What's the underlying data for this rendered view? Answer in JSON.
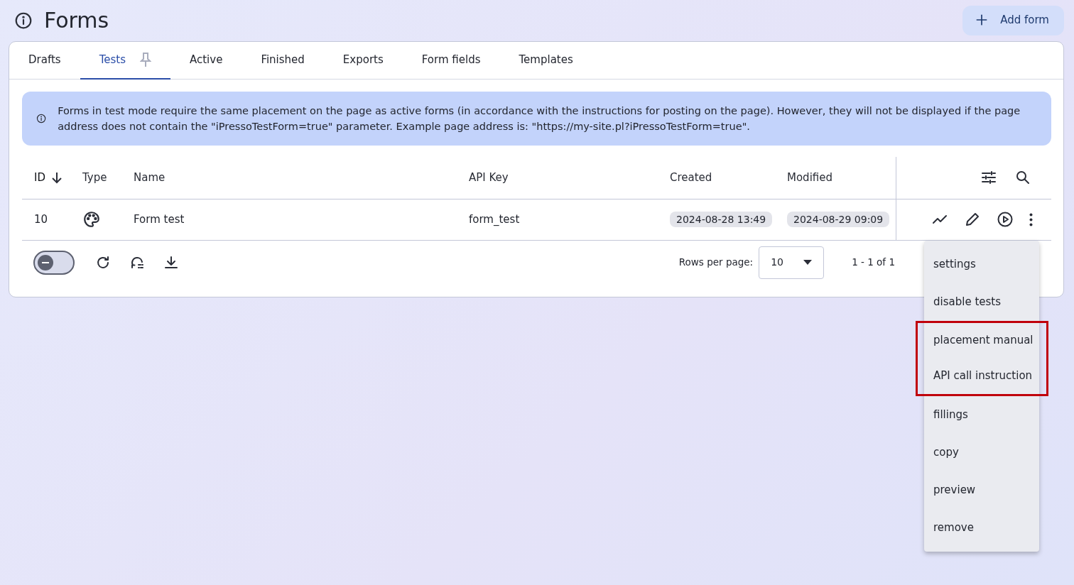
{
  "page": {
    "title": "Forms",
    "add_button": "Add form"
  },
  "tabs": [
    {
      "label": "Drafts",
      "selected": false,
      "pinned": false
    },
    {
      "label": "Tests",
      "selected": true,
      "pinned": true
    },
    {
      "label": "Active",
      "selected": false,
      "pinned": false
    },
    {
      "label": "Finished",
      "selected": false,
      "pinned": false
    },
    {
      "label": "Exports",
      "selected": false,
      "pinned": false
    },
    {
      "label": "Form fields",
      "selected": false,
      "pinned": false
    },
    {
      "label": "Templates",
      "selected": false,
      "pinned": false
    }
  ],
  "alert": "Forms in test mode require the same placement on the page as active forms (in accordance with the instructions for posting on the page). However, they will not be displayed if the page address does not contain the \"iPressoTestForm=true\" parameter. Example page address is: \"https://my-site.pl?iPressoTestForm=true\".",
  "table": {
    "columns": [
      {
        "label": "ID",
        "sorted": true
      },
      {
        "label": "Type",
        "sorted": false
      },
      {
        "label": "Name",
        "sorted": false
      },
      {
        "label": "API Key",
        "sorted": false
      },
      {
        "label": "Created",
        "sorted": false
      },
      {
        "label": "Modified",
        "sorted": false
      }
    ],
    "rows": [
      {
        "id": "10",
        "name": "Form test",
        "api_key": "form_test",
        "created": "2024-08-28 13:49",
        "modified": "2024-08-29 09:09"
      }
    ]
  },
  "footer": {
    "toggle_on": false,
    "rows_per_page_label": "Rows per page:",
    "rows_per_page": "10",
    "range": "1 - 1 of 1"
  },
  "menu": [
    {
      "label": "settings",
      "highlighted": false
    },
    {
      "label": "disable tests",
      "highlighted": false
    },
    {
      "label": "placement manual",
      "highlighted": true
    },
    {
      "label": "API call instruction",
      "highlighted": true
    },
    {
      "label": "fillings",
      "highlighted": false
    },
    {
      "label": "copy",
      "highlighted": false
    },
    {
      "label": "preview",
      "highlighted": false
    },
    {
      "label": "remove",
      "highlighted": false
    }
  ]
}
